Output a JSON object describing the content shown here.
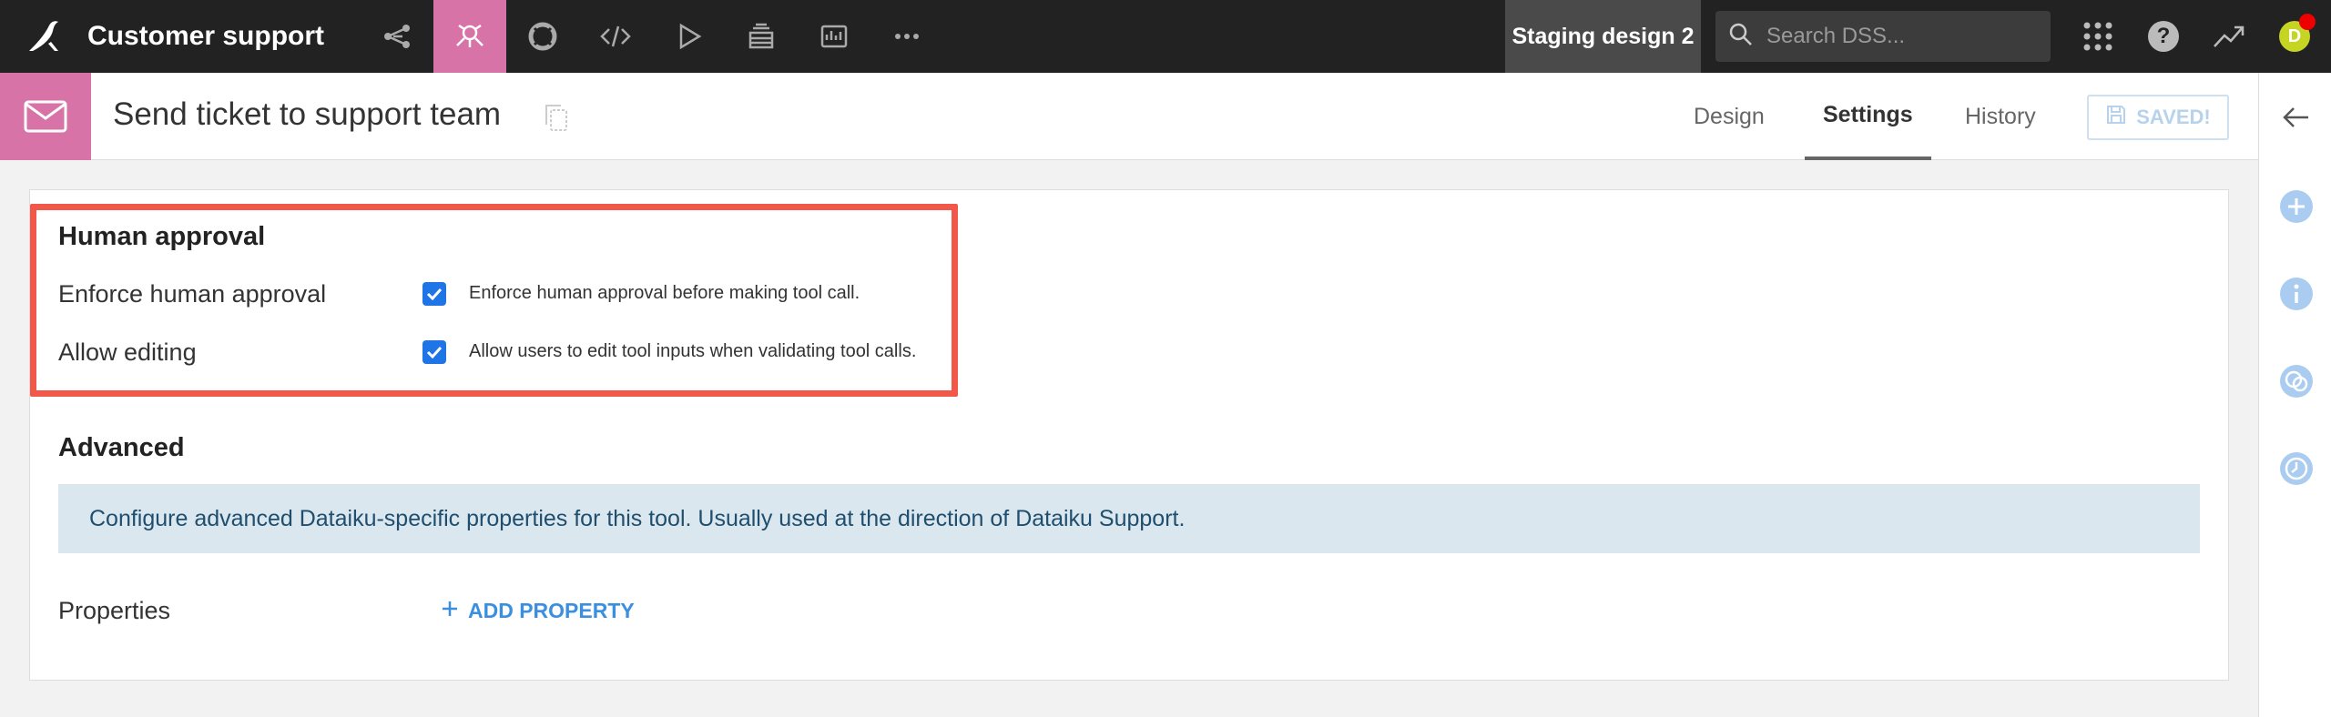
{
  "topbar": {
    "project_title": "Customer support",
    "nav_icons": [
      "flow-icon",
      "agent-icon",
      "lifebuoy-icon",
      "code-icon",
      "run-icon",
      "datasets-icon",
      "dashboard-icon",
      "more-icon"
    ],
    "instance_name": "Staging design 2",
    "search_placeholder": "Search DSS...",
    "help_label": "?",
    "avatar_initial": "D"
  },
  "item": {
    "title": "Send ticket to support team",
    "tabs": [
      {
        "label": "Design"
      },
      {
        "label": "Settings"
      },
      {
        "label": "History"
      }
    ],
    "active_tab": "Settings",
    "saved_label": "SAVED!"
  },
  "human_approval": {
    "section_title": "Human approval",
    "fields": [
      {
        "label": "Enforce human approval",
        "checked": true,
        "description": "Enforce human approval before making tool call."
      },
      {
        "label": "Allow editing",
        "checked": true,
        "description": "Allow users to edit tool inputs when validating tool calls."
      }
    ]
  },
  "advanced": {
    "section_title": "Advanced",
    "info": "Configure advanced Dataiku-specific properties for this tool. Usually used at the direction of Dataiku Support.",
    "properties_label": "Properties",
    "add_property_label": "ADD PROPERTY"
  },
  "colors": {
    "accent_pink": "#d873a8",
    "highlight_red": "#f1584a",
    "checkbox_blue": "#1f74e6",
    "link_blue": "#3b8fe0"
  }
}
